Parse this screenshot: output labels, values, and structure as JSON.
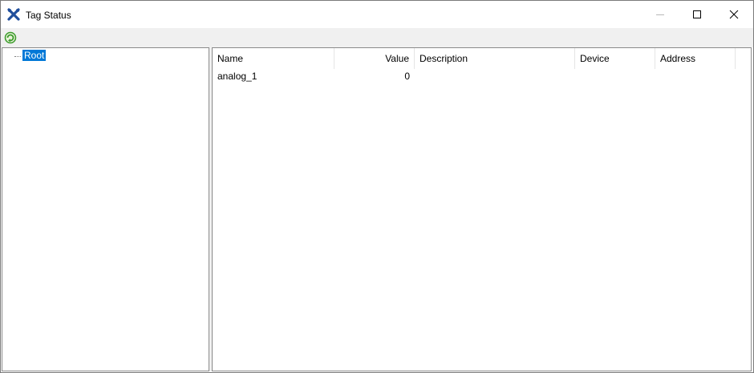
{
  "window": {
    "title": "Tag Status"
  },
  "tree": {
    "root_label": "Root"
  },
  "list": {
    "columns": [
      "Name",
      "Value",
      "Description",
      "Device",
      "Address"
    ],
    "rows": [
      {
        "name": "analog_1",
        "value": "0",
        "description": "",
        "device": "",
        "address": ""
      }
    ]
  },
  "colors": {
    "selection": "#0078d7",
    "app_icon": "#1f4e9c",
    "refresh_icon": "#3a9a2a"
  },
  "icons": {
    "app": "tools-x-icon",
    "refresh": "refresh-icon",
    "minimize": "minimize-icon",
    "maximize": "maximize-icon",
    "close": "close-icon"
  }
}
